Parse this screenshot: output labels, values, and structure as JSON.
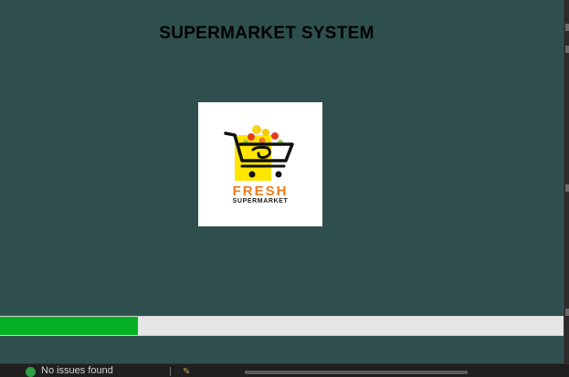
{
  "window": {
    "title": "SUPERMARKET SYSTEM"
  },
  "logo": {
    "brand": "FRESH",
    "sub": "SUPERMARKET",
    "icon": "shopping-cart-icon",
    "colors": {
      "cart_bg": "#ffe600",
      "brand_text": "#f07a1c",
      "cart_lines": "#111111"
    }
  },
  "progress": {
    "fraction": 0.245,
    "fill_color": "#06b025",
    "track_color": "#e6e6e6"
  },
  "statusbar": {
    "issues_text": "No issues found",
    "issues_icon": "check-circle-icon"
  }
}
